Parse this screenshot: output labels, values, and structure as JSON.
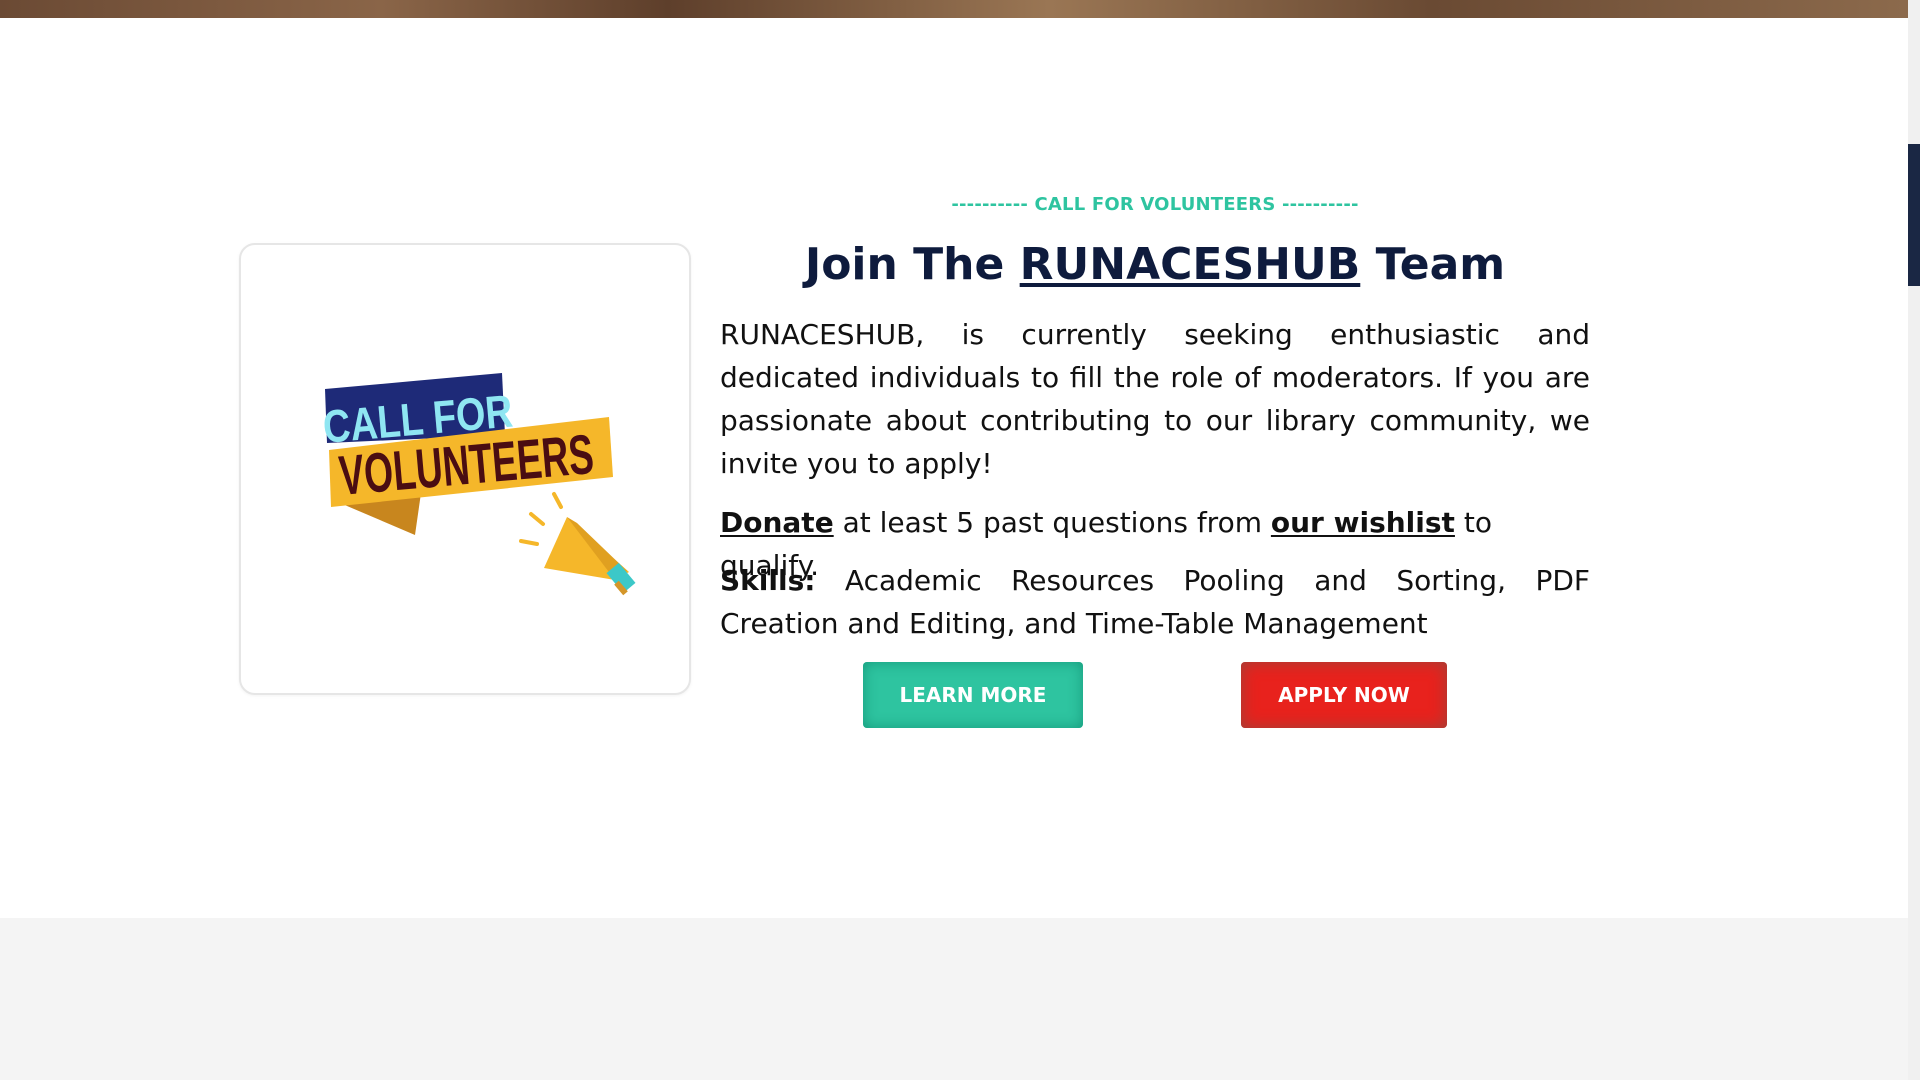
{
  "section": {
    "eyebrow": "---------- CALL FOR VOLUNTEERS ----------",
    "heading_prefix": "Join The ",
    "heading_brand": "RUNACESHUB",
    "heading_suffix": " Team",
    "intro": "RUNACESHUB, is currently seeking enthusiastic and dedicated individuals to fill the role of moderators. If you are passionate about contributing to our library community, we invite you to apply!",
    "donate_link": "Donate",
    "donate_middle": " at least 5 past questions from ",
    "wishlist_link": "our wishlist",
    "donate_end": " to qualify.",
    "skills_label": "Skills:",
    "skills_text": " Academic Resources Pooling and Sorting, PDF Creation and Editing, and Time-Table Management"
  },
  "image": {
    "line1": "CALL FOR",
    "line2": "VOLUNTEERS",
    "icon": "megaphone-icon"
  },
  "buttons": {
    "learn_more": "LEARN MORE",
    "apply_now": "APPLY NOW"
  },
  "colors": {
    "accent": "#2ec4a0",
    "heading": "#0e1b3d",
    "apply": "#e8221d",
    "banner_navy": "#1e2a78",
    "banner_yellow": "#f5b72a",
    "banner_text": "#4a0d12"
  }
}
